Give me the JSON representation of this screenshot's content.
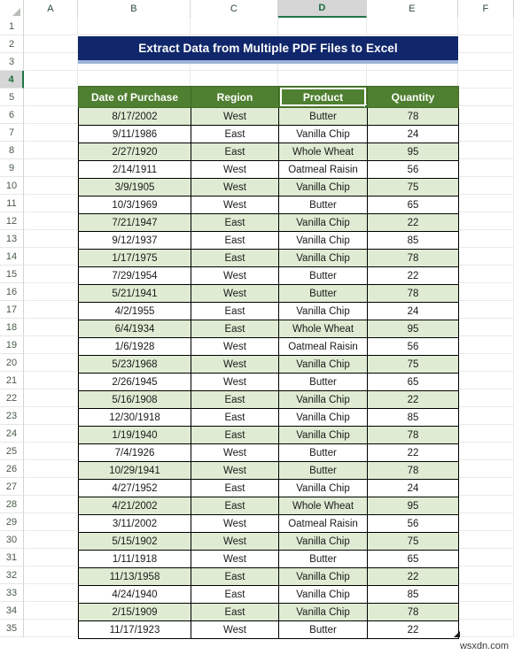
{
  "spreadsheet": {
    "column_headers": [
      "A",
      "B",
      "C",
      "D",
      "E",
      "F"
    ],
    "selected_column": "D",
    "selected_row": "4",
    "selected_cell": "D4",
    "row_numbers": [
      "1",
      "2",
      "3",
      "4",
      "5",
      "6",
      "7",
      "8",
      "9",
      "10",
      "11",
      "12",
      "13",
      "14",
      "15",
      "16",
      "17",
      "18",
      "19",
      "20",
      "21",
      "22",
      "23",
      "24",
      "25",
      "26",
      "27",
      "28",
      "29",
      "30",
      "31",
      "32",
      "33",
      "34",
      "35"
    ],
    "corner_select_all_icon": "select-all-triangle-icon"
  },
  "banner": {
    "title": "Extract Data from Multiple PDF Files to Excel",
    "background_color": "#10276B",
    "accent_color": "#9CB3D9",
    "text_color": "#FFFFFF"
  },
  "table": {
    "header_fill": "#4F7F30",
    "alt_row_fill": "#DFECD3",
    "columns": [
      "Date of Purchase",
      "Region",
      "Product",
      "Quantity"
    ],
    "rows": [
      {
        "date": "8/17/2002",
        "region": "West",
        "product": "Butter",
        "quantity": "78"
      },
      {
        "date": "9/11/1986",
        "region": "East",
        "product": "Vanilla Chip",
        "quantity": "24"
      },
      {
        "date": "2/27/1920",
        "region": "East",
        "product": "Whole Wheat",
        "quantity": "95"
      },
      {
        "date": "2/14/1911",
        "region": "West",
        "product": "Oatmeal Raisin",
        "quantity": "56"
      },
      {
        "date": "3/9/1905",
        "region": "West",
        "product": "Vanilla Chip",
        "quantity": "75"
      },
      {
        "date": "10/3/1969",
        "region": "West",
        "product": "Butter",
        "quantity": "65"
      },
      {
        "date": "7/21/1947",
        "region": "East",
        "product": "Vanilla Chip",
        "quantity": "22"
      },
      {
        "date": "9/12/1937",
        "region": "East",
        "product": "Vanilla Chip",
        "quantity": "85"
      },
      {
        "date": "1/17/1975",
        "region": "East",
        "product": "Vanilla Chip",
        "quantity": "78"
      },
      {
        "date": "7/29/1954",
        "region": "West",
        "product": "Butter",
        "quantity": "22"
      },
      {
        "date": "5/21/1941",
        "region": "West",
        "product": "Butter",
        "quantity": "78"
      },
      {
        "date": "4/2/1955",
        "region": "East",
        "product": "Vanilla Chip",
        "quantity": "24"
      },
      {
        "date": "6/4/1934",
        "region": "East",
        "product": "Whole Wheat",
        "quantity": "95"
      },
      {
        "date": "1/6/1928",
        "region": "West",
        "product": "Oatmeal Raisin",
        "quantity": "56"
      },
      {
        "date": "5/23/1968",
        "region": "West",
        "product": "Vanilla Chip",
        "quantity": "75"
      },
      {
        "date": "2/26/1945",
        "region": "West",
        "product": "Butter",
        "quantity": "65"
      },
      {
        "date": "5/16/1908",
        "region": "East",
        "product": "Vanilla Chip",
        "quantity": "22"
      },
      {
        "date": "12/30/1918",
        "region": "East",
        "product": "Vanilla Chip",
        "quantity": "85"
      },
      {
        "date": "1/19/1940",
        "region": "East",
        "product": "Vanilla Chip",
        "quantity": "78"
      },
      {
        "date": "7/4/1926",
        "region": "West",
        "product": "Butter",
        "quantity": "22"
      },
      {
        "date": "10/29/1941",
        "region": "West",
        "product": "Butter",
        "quantity": "78"
      },
      {
        "date": "4/27/1952",
        "region": "East",
        "product": "Vanilla Chip",
        "quantity": "24"
      },
      {
        "date": "4/21/2002",
        "region": "East",
        "product": "Whole Wheat",
        "quantity": "95"
      },
      {
        "date": "3/11/2002",
        "region": "West",
        "product": "Oatmeal Raisin",
        "quantity": "56"
      },
      {
        "date": "5/15/1902",
        "region": "West",
        "product": "Vanilla Chip",
        "quantity": "75"
      },
      {
        "date": "1/11/1918",
        "region": "West",
        "product": "Butter",
        "quantity": "65"
      },
      {
        "date": "11/13/1958",
        "region": "East",
        "product": "Vanilla Chip",
        "quantity": "22"
      },
      {
        "date": "4/24/1940",
        "region": "East",
        "product": "Vanilla Chip",
        "quantity": "85"
      },
      {
        "date": "2/15/1909",
        "region": "East",
        "product": "Vanilla Chip",
        "quantity": "78"
      },
      {
        "date": "11/17/1923",
        "region": "West",
        "product": "Butter",
        "quantity": "22"
      }
    ]
  },
  "watermark": {
    "text": "wsxdn.com"
  }
}
